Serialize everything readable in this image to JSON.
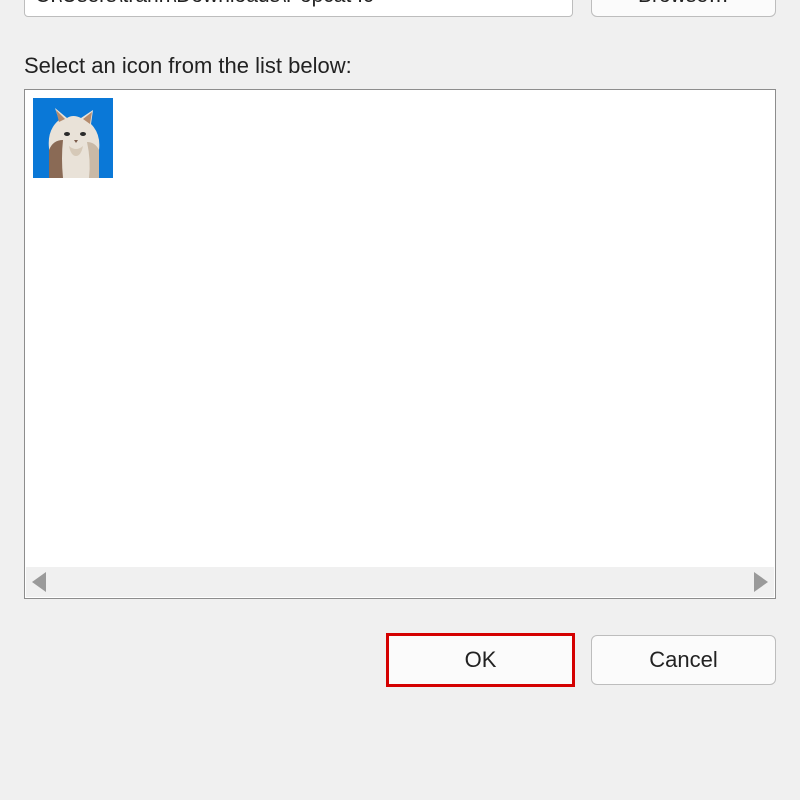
{
  "path_input": {
    "value": "C:\\Users\\trann\\Downloads\\Popcat Ic"
  },
  "browse_button": {
    "label": "Browse…"
  },
  "select_label": "Select an icon from the list below:",
  "icons": [
    {
      "name": "popcat-icon",
      "selected": true
    }
  ],
  "buttons": {
    "ok": "OK",
    "cancel": "Cancel"
  },
  "colors": {
    "selection": "#0a78d7",
    "highlight": "#d40000"
  }
}
